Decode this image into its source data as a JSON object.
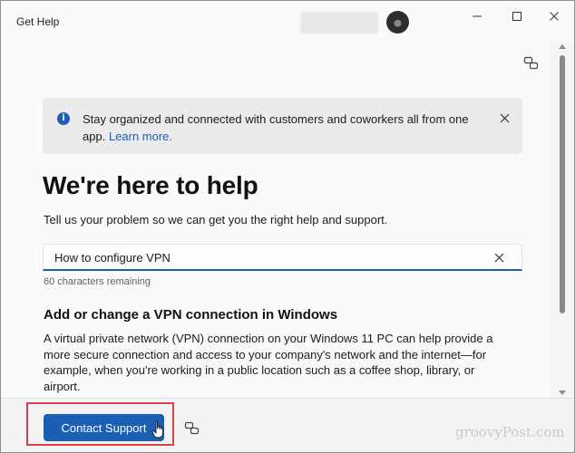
{
  "window": {
    "title": "Get Help",
    "icons": {
      "minimize": "minimize-icon",
      "maximize": "maximize-icon",
      "close": "close-icon"
    }
  },
  "toolbar": {
    "icons": [
      "community-icon",
      "info-icon"
    ]
  },
  "banner": {
    "text": "Stay organized and connected with customers and coworkers all from one app.",
    "link_label": "Learn more.",
    "icon": "info-icon",
    "close_icon": "close-icon"
  },
  "main": {
    "heading": "We're here to help",
    "subtext": "Tell us your problem so we can get you the right help and support.",
    "search": {
      "value": "How to configure VPN",
      "clear_icon": "clear-icon"
    },
    "char_count": "60 characters remaining",
    "section_title": "Add or change a VPN connection in Windows",
    "section_body": "A virtual private network (VPN) connection on your Windows 11 PC can help provide a more secure connection and access to your company's network and the internet—for example, when you're working in a public location such as a coffee shop, library, or airport."
  },
  "footer": {
    "contact_button": "Contact Support",
    "community_icon": "community-icon",
    "watermark": "groovyPost.com"
  },
  "colors": {
    "accent": "#1a5fb4",
    "highlight_border": "#d9414a",
    "banner_bg": "#ebebeb"
  }
}
